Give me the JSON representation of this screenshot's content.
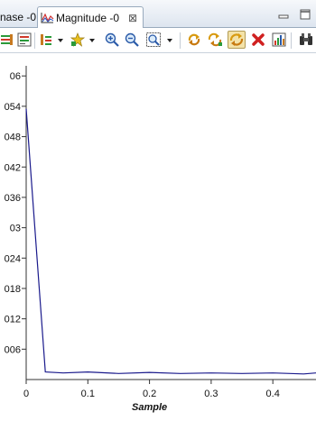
{
  "tabs": [
    {
      "label": "nase -0"
    },
    {
      "label": "Magnitude -0",
      "close": "⊠"
    }
  ],
  "chart_data": {
    "type": "line",
    "xlabel": "Sample",
    "ylabel": "",
    "xlim": [
      0,
      0.47
    ],
    "ylim": [
      0,
      0.062
    ],
    "x_ticks": [
      0,
      0.1,
      0.2,
      0.3,
      0.4
    ],
    "x_tick_labels": [
      "0",
      "0.1",
      "0.2",
      "0.3",
      "0.4"
    ],
    "y_ticks": [
      0.006,
      0.012,
      0.018,
      0.024,
      0.03,
      0.036,
      0.042,
      0.048,
      0.054,
      0.06
    ],
    "y_tick_labels": [
      "006",
      "012",
      "018",
      "024",
      "03",
      "036",
      "042",
      "048",
      "054",
      "06"
    ],
    "series": [
      {
        "color": "#1a1a8c",
        "x": [
          0,
          0.031,
          0.06,
          0.1,
          0.15,
          0.2,
          0.25,
          0.3,
          0.35,
          0.4,
          0.45,
          0.47
        ],
        "y": [
          0.0535,
          0.0015,
          0.0013,
          0.0015,
          0.0012,
          0.0014,
          0.0012,
          0.0013,
          0.0012,
          0.0013,
          0.0011,
          0.0013
        ]
      }
    ],
    "grid": false
  }
}
